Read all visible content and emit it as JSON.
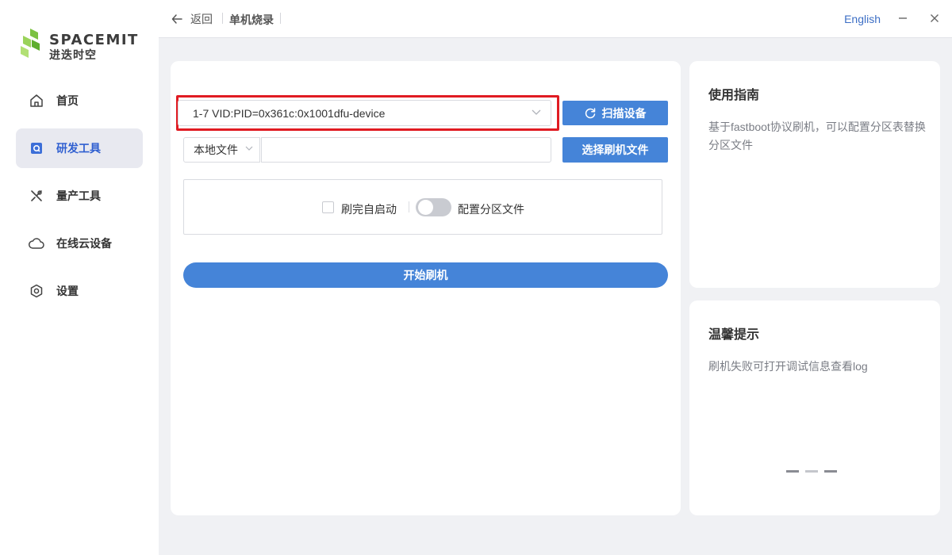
{
  "brand": {
    "name": "SPACEMIT",
    "subtitle": "进迭时空",
    "green": "#7cc242"
  },
  "sidebar": {
    "items": [
      {
        "label": "首页",
        "icon": "home-icon",
        "active": false
      },
      {
        "label": "研发工具",
        "icon": "dev-tools-icon",
        "active": true
      },
      {
        "label": "量产工具",
        "icon": "tools-icon",
        "active": false
      },
      {
        "label": "在线云设备",
        "icon": "cloud-icon",
        "active": false
      },
      {
        "label": "设置",
        "icon": "settings-icon",
        "active": false
      }
    ]
  },
  "topbar": {
    "back_label": "返回",
    "page_title": "单机烧录",
    "language": "English"
  },
  "flash": {
    "device_value": "1-7 VID:PID=0x361c:0x1001dfu-device",
    "scan_button": "扫描设备",
    "source_value": "本地文件",
    "file_path_value": "",
    "select_file_button": "选择刷机文件",
    "auto_start_label": "刷完自启动",
    "auto_start_checked": false,
    "partition_label": "配置分区文件",
    "partition_enabled": false,
    "start_button": "开始刷机"
  },
  "guide": {
    "title": "使用指南",
    "text": "基于fastboot协议刷机，可以配置分区表替换分区文件"
  },
  "tips": {
    "title": "温馨提示",
    "text": "刷机失败可打开调试信息查看log",
    "carousel_pages": 3
  },
  "colors": {
    "accent": "#4584d8",
    "highlight_border": "#e01b22",
    "active_nav": "#e8e9f0"
  }
}
